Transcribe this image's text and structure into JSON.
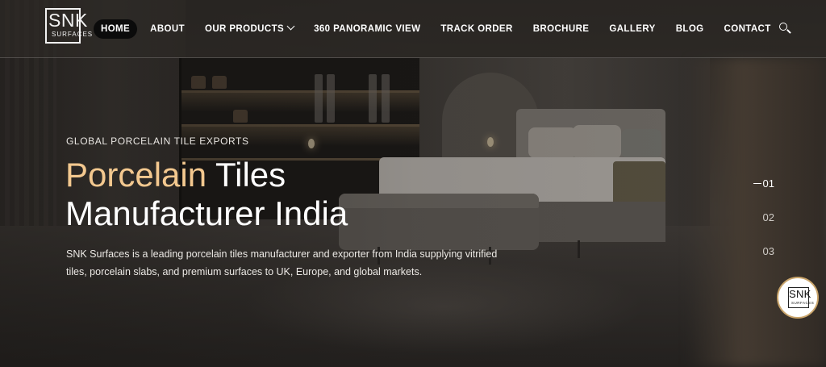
{
  "header": {
    "logo": {
      "main": "SNK",
      "sub": "SURFACES"
    },
    "nav": [
      {
        "label": "HOME",
        "active": true
      },
      {
        "label": "ABOUT"
      },
      {
        "label": "OUR PRODUCTS",
        "has_dropdown": true
      },
      {
        "label": "360 PANORAMIC VIEW"
      },
      {
        "label": "TRACK ORDER"
      },
      {
        "label": "BROCHURE"
      },
      {
        "label": "GALLERY"
      },
      {
        "label": "BLOG"
      },
      {
        "label": "CONTACT"
      }
    ],
    "search_icon": "search-icon"
  },
  "hero": {
    "eyebrow": "GLOBAL PORCELAIN TILE EXPORTS",
    "headline_accent": "Porcelain",
    "headline_rest_line1": " Tiles",
    "headline_line2": "Manufacturer India",
    "description": "SNK Surfaces is a leading porcelain tiles manufacturer and exporter from India supplying vitrified tiles, porcelain slabs, and premium surfaces to UK, Europe, and global markets.",
    "accent_color": "#f3c88f"
  },
  "slider": {
    "slides": [
      "01",
      "02",
      "03"
    ],
    "active_index": 0
  },
  "badge": {
    "main": "SNK",
    "sub": "SURFACES"
  }
}
